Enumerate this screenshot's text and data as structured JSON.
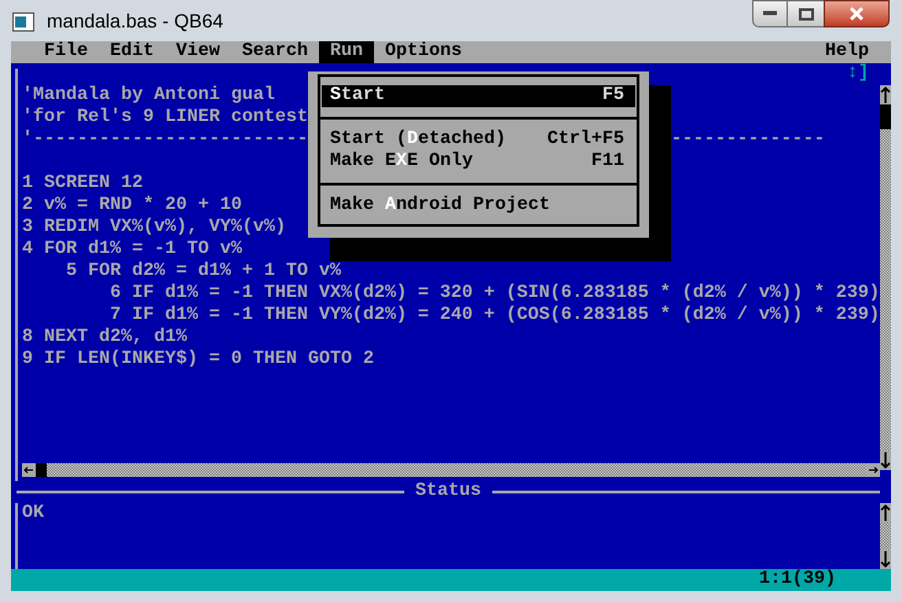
{
  "window": {
    "title": "mandala.bas - QB64"
  },
  "menu_bar": [
    {
      "label": "File",
      "selected": false
    },
    {
      "label": "Edit",
      "selected": false
    },
    {
      "label": "View",
      "selected": false
    },
    {
      "label": "Search",
      "selected": false
    },
    {
      "label": "Run",
      "selected": true
    },
    {
      "label": "Options",
      "selected": false
    },
    {
      "label": "Help",
      "selected": false
    }
  ],
  "editor": {
    "scroll_indicator": "↕]",
    "lines": [
      {
        "kind": "code",
        "text": "'Mandala by Antoni gual"
      },
      {
        "kind": "code",
        "text": "'for Rel's 9 LINER contest"
      },
      {
        "kind": "split",
        "segments": [
          "'-------------------------",
          "--------------"
        ]
      },
      {
        "kind": "blank"
      },
      {
        "kind": "code",
        "text": "1 SCREEN 12"
      },
      {
        "kind": "code",
        "text": "2 v% = RND * 20 + 10"
      },
      {
        "kind": "code",
        "text": "3 REDIM VX%(v%), VY%(v%)"
      },
      {
        "kind": "code",
        "text": "4 FOR d1% = -1 TO v%"
      },
      {
        "kind": "code",
        "text": "    5 FOR d2% = d1% + 1 TO v%"
      },
      {
        "kind": "code",
        "text": "        6 IF d1% = -1 THEN VX%(d2%) = 320 + (SIN(6.283185 * (d2% / v%)) * 239)"
      },
      {
        "kind": "code",
        "text": "        7 IF d1% = -1 THEN VY%(d2%) = 240 + (COS(6.283185 * (d2% / v%)) * 239)"
      },
      {
        "kind": "code",
        "text": "8 NEXT d2%, d1%"
      },
      {
        "kind": "code",
        "text": "9 IF LEN(INKEY$) = 0 THEN GOTO 2"
      }
    ]
  },
  "run_menu": {
    "items": [
      {
        "kind": "item",
        "label": "**S**tart",
        "shortcut": "F5",
        "selected": true
      },
      {
        "kind": "separator"
      },
      {
        "kind": "item",
        "label": "Start (**D**etached)",
        "shortcut": "Ctrl+F5",
        "selected": false
      },
      {
        "kind": "item",
        "label": "Make E**X**E Only",
        "shortcut": "F11",
        "selected": false
      },
      {
        "kind": "separator"
      },
      {
        "kind": "item",
        "label": "Make **A**ndroid Project",
        "selected": false
      }
    ]
  },
  "status": {
    "title": "Status",
    "message": "OK"
  },
  "status_bar": {
    "position": "1:1(39)"
  }
}
